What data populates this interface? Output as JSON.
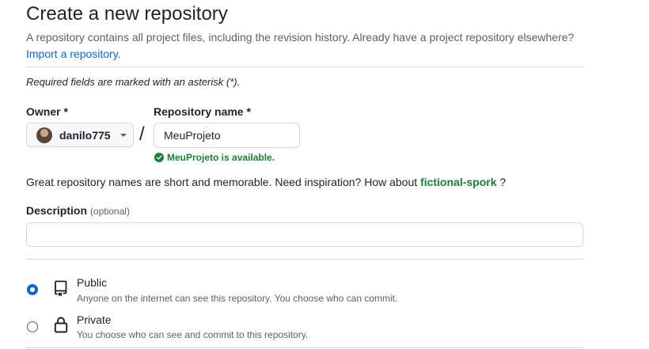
{
  "header": {
    "title": "Create a new repository",
    "subtitle": "A repository contains all project files, including the revision history. Already have a project repository elsewhere?",
    "import_link": "Import a repository."
  },
  "form": {
    "required_note": "Required fields are marked with an asterisk (*).",
    "owner": {
      "label": "Owner *",
      "value": "danilo775"
    },
    "separator": "/",
    "repo_name": {
      "label": "Repository name *",
      "value": "MeuProjeto",
      "availability": "MeuProjeto is available."
    },
    "inspiration": {
      "prefix": "Great repository names are short and memorable. Need inspiration? How about",
      "suggestion": "fictional-spork",
      "suffix": "?"
    },
    "description": {
      "label": "Description",
      "optional": "(optional)",
      "value": ""
    },
    "visibility": [
      {
        "title": "Public",
        "desc": "Anyone on the internet can see this repository. You choose who can commit.",
        "selected": true,
        "icon": "repo-icon"
      },
      {
        "title": "Private",
        "desc": "You choose who can see and commit to this repository.",
        "selected": false,
        "icon": "lock-icon"
      }
    ]
  },
  "colors": {
    "link": "#0969da",
    "success": "#1a7f37",
    "border": "#d1d9e0",
    "muted": "#59636e"
  }
}
